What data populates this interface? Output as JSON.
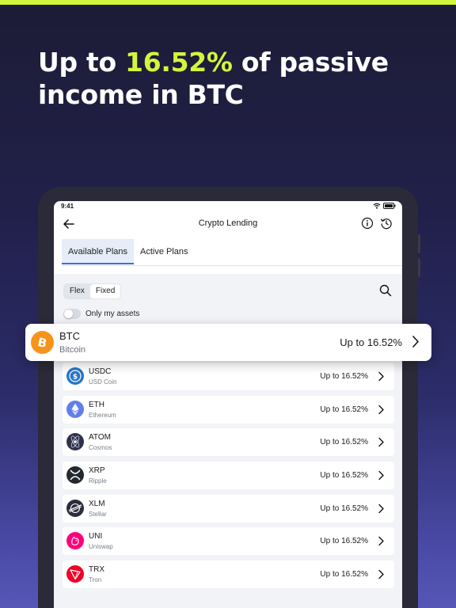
{
  "headline": {
    "prefix": "Up to ",
    "highlight": "16.52%",
    "suffix": " of passive income in BTC"
  },
  "status_bar": {
    "time": "9:41"
  },
  "nav": {
    "title": "Crypto Lending"
  },
  "tabs": [
    {
      "label": "Available Plans",
      "active": true
    },
    {
      "label": "Active Plans",
      "active": false
    }
  ],
  "filter": {
    "segments": [
      {
        "label": "Flex",
        "selected": false
      },
      {
        "label": "Fixed",
        "selected": true
      }
    ],
    "toggle_label": "Only my assets",
    "toggle_on": false
  },
  "featured": {
    "symbol": "BTC",
    "name": "Bitcoin",
    "rate": "Up to 16.52%",
    "icon": "bitcoin-icon",
    "color": "#f7931a"
  },
  "assets": [
    {
      "symbol": "USDC",
      "name": "USD Coin",
      "rate": "Up to 16.52%",
      "icon": "usdc-icon",
      "color": "#2775ca"
    },
    {
      "symbol": "ETH",
      "name": "Ethereum",
      "rate": "Up to 16.52%",
      "icon": "ethereum-icon",
      "color": "#627eea"
    },
    {
      "symbol": "ATOM",
      "name": "Cosmos",
      "rate": "Up to 16.52%",
      "icon": "cosmos-icon",
      "color": "#2e3148"
    },
    {
      "symbol": "XRP",
      "name": "Ripple",
      "rate": "Up to 16.52%",
      "icon": "xrp-icon",
      "color": "#23292f"
    },
    {
      "symbol": "XLM",
      "name": "Stellar",
      "rate": "Up to 16.52%",
      "icon": "stellar-icon",
      "color": "#2a2e3a"
    },
    {
      "symbol": "UNI",
      "name": "Uniswap",
      "rate": "Up to 16.52%",
      "icon": "uniswap-icon",
      "color": "#ff007a"
    },
    {
      "symbol": "TRX",
      "name": "Tron",
      "rate": "Up to 16.52%",
      "icon": "tron-icon",
      "color": "#ef0027"
    }
  ],
  "colors": {
    "accent": "#d4f53c",
    "tab_active": "#3e6fd8"
  }
}
